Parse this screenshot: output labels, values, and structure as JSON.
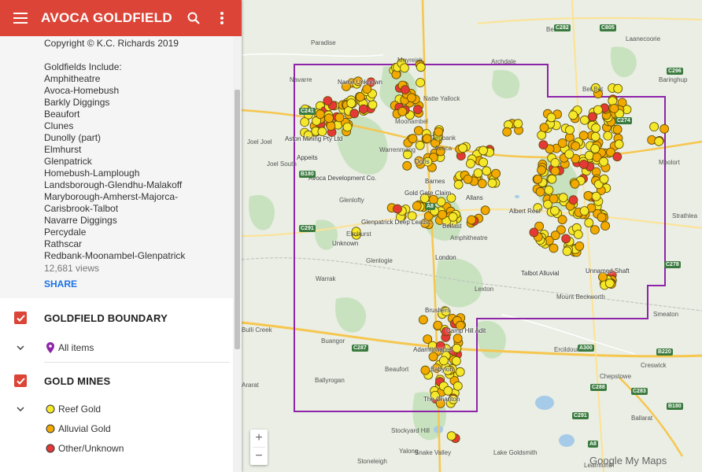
{
  "header": {
    "title": "AVOCA GOLDFIELD DISTRICT",
    "color": "#db4437",
    "menu_icon": "menu-icon",
    "search_icon": "search-icon",
    "more_icon": "more-vert-icon"
  },
  "description": {
    "copyright": "Copyright © K.C. Richards 2019",
    "goldfields_heading": "Goldfields Include:",
    "goldfields": [
      "Amphitheatre",
      "Avoca-Homebush",
      "Barkly Diggings",
      "Beaufort",
      "Clunes",
      "Dunolly (part)",
      "Elmhurst",
      "Glenpatrick",
      "Homebush-Lamplough",
      "Landsborough-Glendhu-Malakoff",
      "Maryborough-Amherst-Majorca-",
      "Carisbrook-Talbot",
      "Navarre Diggings",
      "Percydale",
      "Rathscar",
      "Redbank-Moonambel-Glenpatrick"
    ],
    "views": "12,681 views",
    "share_label": "SHARE"
  },
  "layers": [
    {
      "title": "GOLDFIELD BOUNDARY",
      "checked": true,
      "items": [
        {
          "label": "All items",
          "icon": "map-pin-icon",
          "color": "#8e24aa"
        }
      ]
    },
    {
      "title": "GOLD MINES",
      "checked": true,
      "items": [
        {
          "label": "Reef Gold",
          "icon": "circle-icon",
          "color": "#f5e82a"
        },
        {
          "label": "Alluvial Gold",
          "icon": "circle-icon",
          "color": "#f2a900"
        },
        {
          "label": "Other/Unknown",
          "icon": "circle-icon",
          "color": "#e53935"
        }
      ]
    }
  ],
  "map": {
    "boundary_color": "#8e24aa",
    "towns": [
      "Moyreisk",
      "Archdale",
      "Bealiba",
      "Laanecoorie",
      "Paradise",
      "Navarre",
      "Natte Yallock",
      "Bet Bet",
      "Baringhup",
      "Joel Joel",
      "Joel South",
      "Warrenmang",
      "Moonambel",
      "Redbank",
      "Avoca",
      "Moolort",
      "Strathlea",
      "Glenlofty",
      "Elmhurst",
      "Amphitheatre",
      "Glenlogie",
      "Lexton",
      "Warrak",
      "Mount Beckworth",
      "Smeaton",
      "Ercildoune",
      "Buangor",
      "Beaufort",
      "Ballyrogan",
      "Snake Valley",
      "Lake Goldsmith",
      "Chepstowe",
      "Stoneleigh",
      "Learmonth",
      "Creswick",
      "Ballarat",
      "Bulli Creek",
      "Stockyard Hill",
      "Yalong",
      "Ararat"
    ],
    "site_labels": [
      "Name Unknown",
      "Aston Mining Pty Ltd",
      "Appeits",
      "Avoca Development Co.",
      "Doris",
      "Barnes",
      "Gold Gate Claim",
      "Glenpatrick Deep Leads...",
      "Allans",
      "Belfast",
      "London",
      "Albert Reef",
      "Talbot Alluvial",
      "Unnamed Shaft",
      "Unknown",
      "Brushers",
      "Camp Hill Adit",
      "Adamthwaites",
      "Babylon",
      "The Chariton"
    ],
    "road_shields": [
      "C241",
      "B180",
      "A8",
      "C287",
      "C291",
      "A300",
      "B220",
      "C283",
      "C288",
      "C278",
      "C274",
      "C282",
      "C805",
      "C296",
      "C291",
      "A8",
      "B180"
    ],
    "zoom_in_label": "+",
    "zoom_out_label": "−",
    "brand": "Google My Maps"
  }
}
